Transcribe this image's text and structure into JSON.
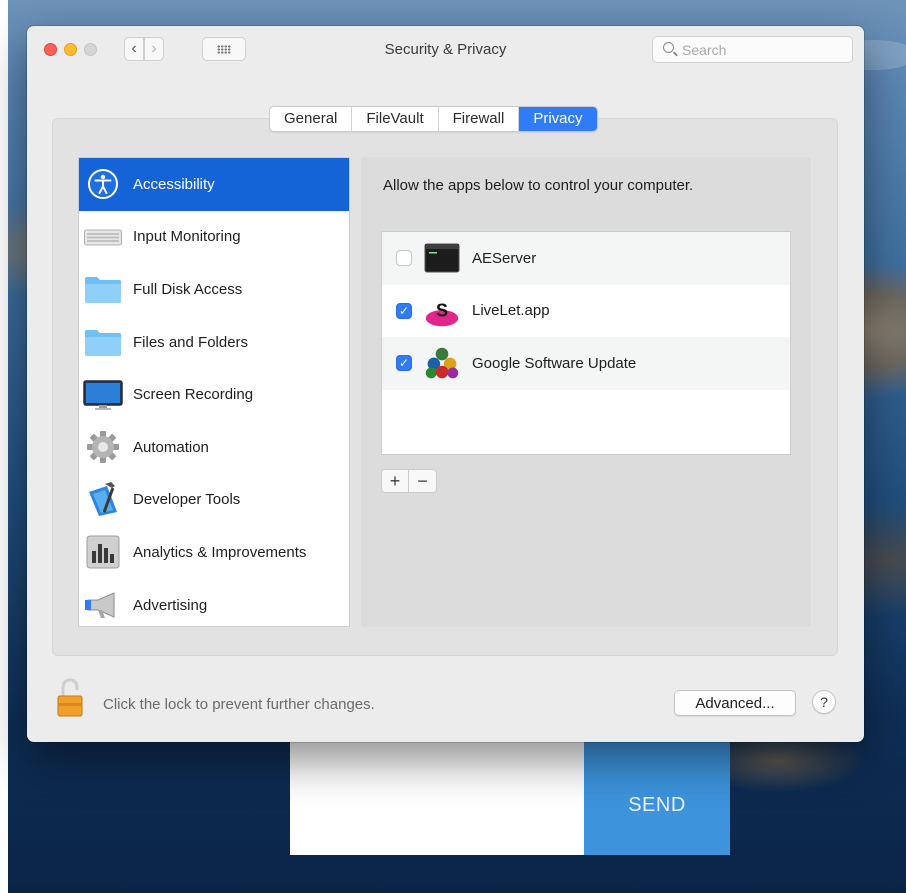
{
  "window": {
    "title": "Security & Privacy",
    "search_placeholder": "Search"
  },
  "tabs": [
    {
      "label": "General",
      "active": false
    },
    {
      "label": "FileVault",
      "active": false
    },
    {
      "label": "Firewall",
      "active": false
    },
    {
      "label": "Privacy",
      "active": true
    }
  ],
  "sidebar": {
    "items": [
      {
        "label": "Accessibility",
        "icon": "accessibility-icon",
        "selected": true
      },
      {
        "label": "Input Monitoring",
        "icon": "keyboard-icon",
        "selected": false
      },
      {
        "label": "Full Disk Access",
        "icon": "folder-icon",
        "selected": false
      },
      {
        "label": "Files and Folders",
        "icon": "folder-icon",
        "selected": false
      },
      {
        "label": "Screen Recording",
        "icon": "display-icon",
        "selected": false
      },
      {
        "label": "Automation",
        "icon": "gear-icon",
        "selected": false
      },
      {
        "label": "Developer Tools",
        "icon": "xcode-hammer-icon",
        "selected": false
      },
      {
        "label": "Analytics & Improvements",
        "icon": "bar-chart-icon",
        "selected": false
      },
      {
        "label": "Advertising",
        "icon": "megaphone-icon",
        "selected": false
      }
    ]
  },
  "pane": {
    "description": "Allow the apps below to control your computer.",
    "apps": [
      {
        "name": "AEServer",
        "checked": false,
        "icon": "terminal-icon"
      },
      {
        "name": "LiveLet.app",
        "checked": true,
        "icon": "livelet-icon"
      },
      {
        "name": "Google Software Update",
        "checked": true,
        "icon": "google-update-icon"
      }
    ],
    "add_label": "+",
    "remove_label": "−"
  },
  "footer": {
    "lock_text": "Click the lock to prevent further changes.",
    "advanced_label": "Advanced...",
    "help_label": "?"
  },
  "background": {
    "send_label": "SEND"
  },
  "colors": {
    "accent": "#2f7cf6",
    "selection": "#1464d8",
    "send_button": "#3d93dc"
  }
}
